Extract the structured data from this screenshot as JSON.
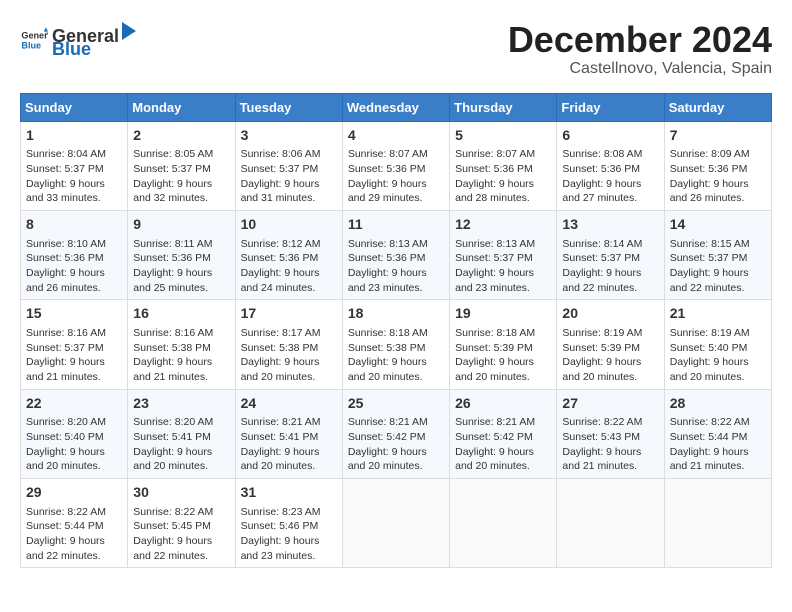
{
  "header": {
    "logo_general": "General",
    "logo_blue": "Blue",
    "month_title": "December 2024",
    "location": "Castellnovo, Valencia, Spain"
  },
  "days_of_week": [
    "Sunday",
    "Monday",
    "Tuesday",
    "Wednesday",
    "Thursday",
    "Friday",
    "Saturday"
  ],
  "weeks": [
    [
      {
        "day": "1",
        "sunrise": "8:04 AM",
        "sunset": "5:37 PM",
        "daylight": "9 hours and 33 minutes."
      },
      {
        "day": "2",
        "sunrise": "8:05 AM",
        "sunset": "5:37 PM",
        "daylight": "9 hours and 32 minutes."
      },
      {
        "day": "3",
        "sunrise": "8:06 AM",
        "sunset": "5:37 PM",
        "daylight": "9 hours and 31 minutes."
      },
      {
        "day": "4",
        "sunrise": "8:07 AM",
        "sunset": "5:36 PM",
        "daylight": "9 hours and 29 minutes."
      },
      {
        "day": "5",
        "sunrise": "8:07 AM",
        "sunset": "5:36 PM",
        "daylight": "9 hours and 28 minutes."
      },
      {
        "day": "6",
        "sunrise": "8:08 AM",
        "sunset": "5:36 PM",
        "daylight": "9 hours and 27 minutes."
      },
      {
        "day": "7",
        "sunrise": "8:09 AM",
        "sunset": "5:36 PM",
        "daylight": "9 hours and 26 minutes."
      }
    ],
    [
      {
        "day": "8",
        "sunrise": "8:10 AM",
        "sunset": "5:36 PM",
        "daylight": "9 hours and 26 minutes."
      },
      {
        "day": "9",
        "sunrise": "8:11 AM",
        "sunset": "5:36 PM",
        "daylight": "9 hours and 25 minutes."
      },
      {
        "day": "10",
        "sunrise": "8:12 AM",
        "sunset": "5:36 PM",
        "daylight": "9 hours and 24 minutes."
      },
      {
        "day": "11",
        "sunrise": "8:13 AM",
        "sunset": "5:36 PM",
        "daylight": "9 hours and 23 minutes."
      },
      {
        "day": "12",
        "sunrise": "8:13 AM",
        "sunset": "5:37 PM",
        "daylight": "9 hours and 23 minutes."
      },
      {
        "day": "13",
        "sunrise": "8:14 AM",
        "sunset": "5:37 PM",
        "daylight": "9 hours and 22 minutes."
      },
      {
        "day": "14",
        "sunrise": "8:15 AM",
        "sunset": "5:37 PM",
        "daylight": "9 hours and 22 minutes."
      }
    ],
    [
      {
        "day": "15",
        "sunrise": "8:16 AM",
        "sunset": "5:37 PM",
        "daylight": "9 hours and 21 minutes."
      },
      {
        "day": "16",
        "sunrise": "8:16 AM",
        "sunset": "5:38 PM",
        "daylight": "9 hours and 21 minutes."
      },
      {
        "day": "17",
        "sunrise": "8:17 AM",
        "sunset": "5:38 PM",
        "daylight": "9 hours and 20 minutes."
      },
      {
        "day": "18",
        "sunrise": "8:18 AM",
        "sunset": "5:38 PM",
        "daylight": "9 hours and 20 minutes."
      },
      {
        "day": "19",
        "sunrise": "8:18 AM",
        "sunset": "5:39 PM",
        "daylight": "9 hours and 20 minutes."
      },
      {
        "day": "20",
        "sunrise": "8:19 AM",
        "sunset": "5:39 PM",
        "daylight": "9 hours and 20 minutes."
      },
      {
        "day": "21",
        "sunrise": "8:19 AM",
        "sunset": "5:40 PM",
        "daylight": "9 hours and 20 minutes."
      }
    ],
    [
      {
        "day": "22",
        "sunrise": "8:20 AM",
        "sunset": "5:40 PM",
        "daylight": "9 hours and 20 minutes."
      },
      {
        "day": "23",
        "sunrise": "8:20 AM",
        "sunset": "5:41 PM",
        "daylight": "9 hours and 20 minutes."
      },
      {
        "day": "24",
        "sunrise": "8:21 AM",
        "sunset": "5:41 PM",
        "daylight": "9 hours and 20 minutes."
      },
      {
        "day": "25",
        "sunrise": "8:21 AM",
        "sunset": "5:42 PM",
        "daylight": "9 hours and 20 minutes."
      },
      {
        "day": "26",
        "sunrise": "8:21 AM",
        "sunset": "5:42 PM",
        "daylight": "9 hours and 20 minutes."
      },
      {
        "day": "27",
        "sunrise": "8:22 AM",
        "sunset": "5:43 PM",
        "daylight": "9 hours and 21 minutes."
      },
      {
        "day": "28",
        "sunrise": "8:22 AM",
        "sunset": "5:44 PM",
        "daylight": "9 hours and 21 minutes."
      }
    ],
    [
      {
        "day": "29",
        "sunrise": "8:22 AM",
        "sunset": "5:44 PM",
        "daylight": "9 hours and 22 minutes."
      },
      {
        "day": "30",
        "sunrise": "8:22 AM",
        "sunset": "5:45 PM",
        "daylight": "9 hours and 22 minutes."
      },
      {
        "day": "31",
        "sunrise": "8:23 AM",
        "sunset": "5:46 PM",
        "daylight": "9 hours and 23 minutes."
      },
      null,
      null,
      null,
      null
    ]
  ]
}
